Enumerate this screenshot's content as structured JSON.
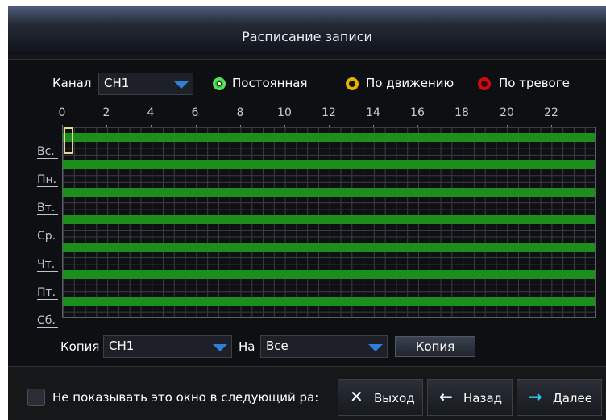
{
  "window": {
    "title": "Расписание записи"
  },
  "channel": {
    "label": "Канал",
    "value": "CH1"
  },
  "modes": [
    {
      "label": "Постоянная",
      "color": "#2bc42b"
    },
    {
      "label": "По движению",
      "color": "#e4b300"
    },
    {
      "label": "По тревоге",
      "color": "#d00b0b"
    }
  ],
  "timeline": {
    "hours": [
      "0",
      "2",
      "4",
      "6",
      "8",
      "10",
      "12",
      "14",
      "16",
      "18",
      "20",
      "22"
    ]
  },
  "schedule": {
    "days": [
      "Вс.",
      "Пн.",
      "Вт.",
      "Ср.",
      "Чт.",
      "Пт.",
      "Сб."
    ],
    "bar_color": "#1b8e1b"
  },
  "copy": {
    "label": "Копия",
    "from_value": "CH1",
    "to_label": "На",
    "to_value": "Все",
    "button": "Копия"
  },
  "footer": {
    "checkbox_label": "Не показывать это окно в следующий ра:",
    "exit": "Выход",
    "back": "Назад",
    "next": "Далее",
    "next_color": "#2ec7f2"
  },
  "icons": {
    "exit": "close-icon",
    "back": "arrow-left-icon",
    "next": "arrow-right-icon"
  }
}
